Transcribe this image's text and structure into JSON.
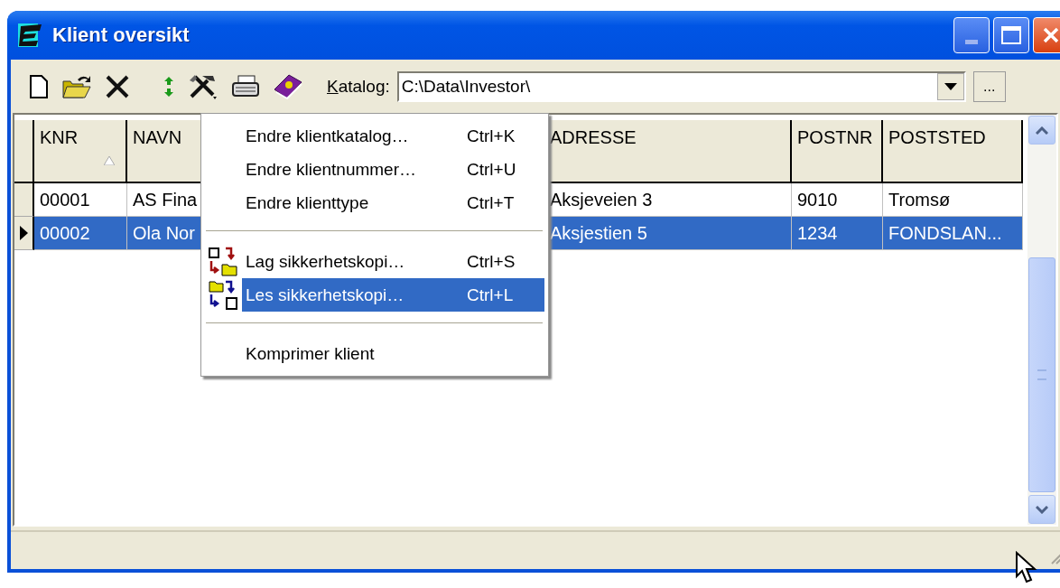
{
  "window": {
    "title": "Klient oversikt"
  },
  "katalog": {
    "label": "Katalog:",
    "value": "C:\\Data\\Investor\\",
    "browse": "..."
  },
  "table": {
    "columns": [
      {
        "label": "KNR",
        "sorted": true
      },
      {
        "label": "NAVN",
        "sorted": false
      },
      {
        "label": "ADRESSE",
        "sorted": false
      },
      {
        "label": "POSTNR",
        "sorted": false
      },
      {
        "label": "POSTSTED",
        "sorted": false
      }
    ],
    "rows": [
      {
        "selected": false,
        "cells": [
          "00001",
          "AS Fina",
          "Aksjeveien 3",
          "9010",
          "Tromsø"
        ]
      },
      {
        "selected": true,
        "cells": [
          "00002",
          "Ola Nor",
          "Aksjestien 5",
          "1234",
          "FONDSLAN..."
        ]
      }
    ]
  },
  "context_menu": {
    "items": [
      {
        "kind": "item",
        "label": "Endre klientkatalog…",
        "shortcut": "Ctrl+K",
        "selected": false
      },
      {
        "kind": "item",
        "label": "Endre klientnummer…",
        "shortcut": "Ctrl+U",
        "selected": false
      },
      {
        "kind": "item",
        "label": "Endre klienttype",
        "shortcut": "Ctrl+T",
        "selected": false
      },
      {
        "kind": "separator"
      },
      {
        "kind": "backup",
        "label": "Lag sikkerhetskopi…",
        "shortcut": "Ctrl+S",
        "selected": false
      },
      {
        "kind": "restore",
        "label": "Les sikkerhetskopi…",
        "shortcut": "Ctrl+L",
        "selected": true
      },
      {
        "kind": "separator"
      },
      {
        "kind": "item",
        "label": "Komprimer klient",
        "selected": false
      }
    ]
  }
}
